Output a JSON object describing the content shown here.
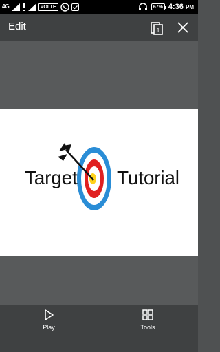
{
  "status_bar": {
    "network_label": "4G",
    "volte": "VOLTE",
    "battery": "67%",
    "time": "4:36",
    "ampm": "PM"
  },
  "app_bar": {
    "title": "Edit",
    "copy_badge": "1"
  },
  "image": {
    "logo_left": "Target",
    "logo_right": "Tutorial"
  },
  "bottom_bar": {
    "play_label": "Play",
    "tools_label": "Tools"
  },
  "colors": {
    "target_outer": "#2a8dd6",
    "target_inner": "#e02020",
    "target_center": "#ffd21a"
  }
}
